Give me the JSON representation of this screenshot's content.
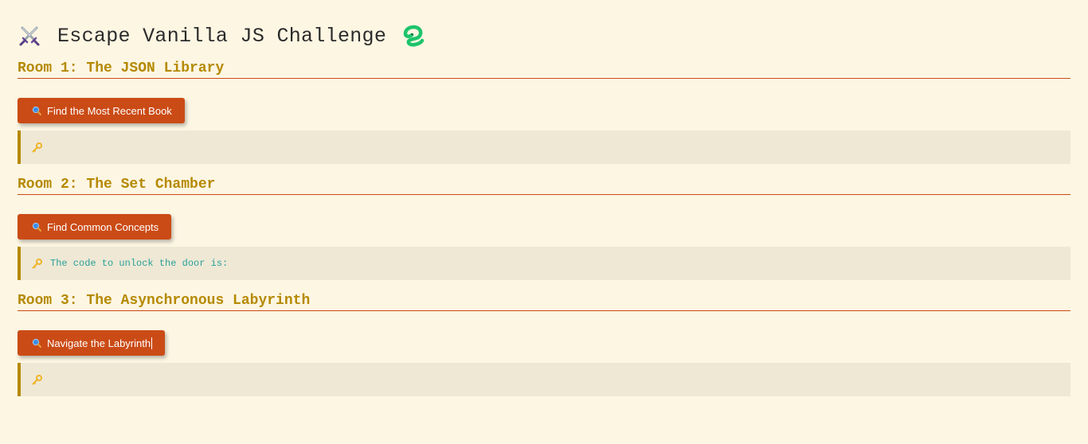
{
  "header": {
    "title": "Escape Vanilla JS Challenge",
    "left_icon": "crossed-swords-icon",
    "right_icon": "snake-icon"
  },
  "colors": {
    "background": "#fdf6e3",
    "heading": "#b58900",
    "button": "#cb4b16",
    "result_bg": "#eee8d5",
    "result_text": "#2aa198"
  },
  "rooms": [
    {
      "heading": "Room 1: The JSON Library",
      "button_label": "Find the Most Recent Book",
      "button_icon": "magnifier-icon",
      "result_icon": "key-icon",
      "result_text": ""
    },
    {
      "heading": "Room 2: The Set Chamber",
      "button_label": "Find Common Concepts",
      "button_icon": "magnifier-icon",
      "result_icon": "key-icon",
      "result_text": "The code to unlock the door is:"
    },
    {
      "heading": "Room 3: The Asynchronous Labyrinth",
      "button_label": "Navigate the Labyrinth",
      "button_icon": "magnifier-icon",
      "result_icon": "key-icon",
      "result_text": ""
    }
  ]
}
